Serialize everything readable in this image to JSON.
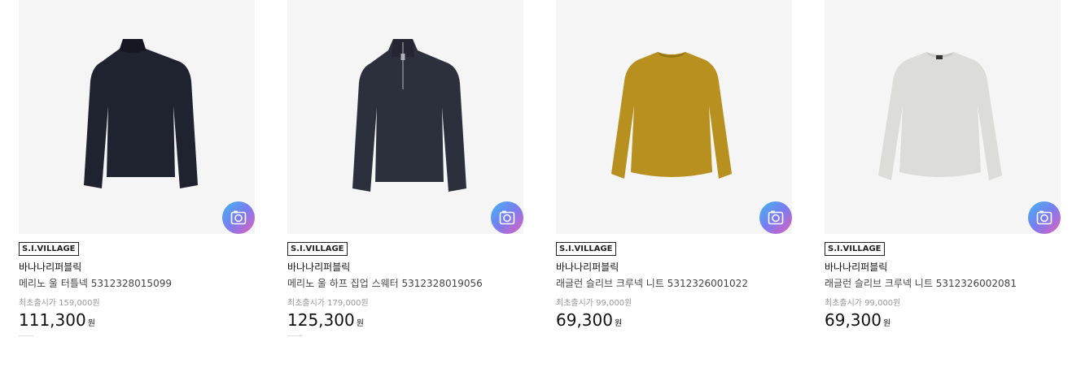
{
  "products": [
    {
      "badge": "S.I.VILLAGE",
      "brand": "바나나리퍼블릭",
      "name": "메리노 울 터틀넥 5312328015099",
      "original_price": "최초출시가 159,000원",
      "price": "111,300",
      "currency": "원",
      "garment_color": "#1f2330",
      "garment_style": "turtleneck"
    },
    {
      "badge": "S.I.VILLAGE",
      "brand": "바나나리퍼블릭",
      "name": "메리노 울 하프 집업 스웨터 5312328019056",
      "original_price": "최초출시가 179,000원",
      "price": "125,300",
      "currency": "원",
      "garment_color": "#2c2f3c",
      "garment_style": "half-zip"
    },
    {
      "badge": "S.I.VILLAGE",
      "brand": "바나나리퍼블릭",
      "name": "래글런 슬리브 크루넥 니트 5312326001022",
      "original_price": "최초출시가 99,000원",
      "price": "69,300",
      "currency": "원",
      "garment_color": "#b8901f",
      "garment_style": "crewneck"
    },
    {
      "badge": "S.I.VILLAGE",
      "brand": "바나나리퍼블릭",
      "name": "래글런 슬리브 크루넥 니트 5312326002081",
      "original_price": "최초출시가 99,000원",
      "price": "69,300",
      "currency": "원",
      "garment_color": "#dcdcda",
      "garment_style": "crewneck"
    }
  ],
  "icons": {
    "camera": "camera-search-icon"
  }
}
